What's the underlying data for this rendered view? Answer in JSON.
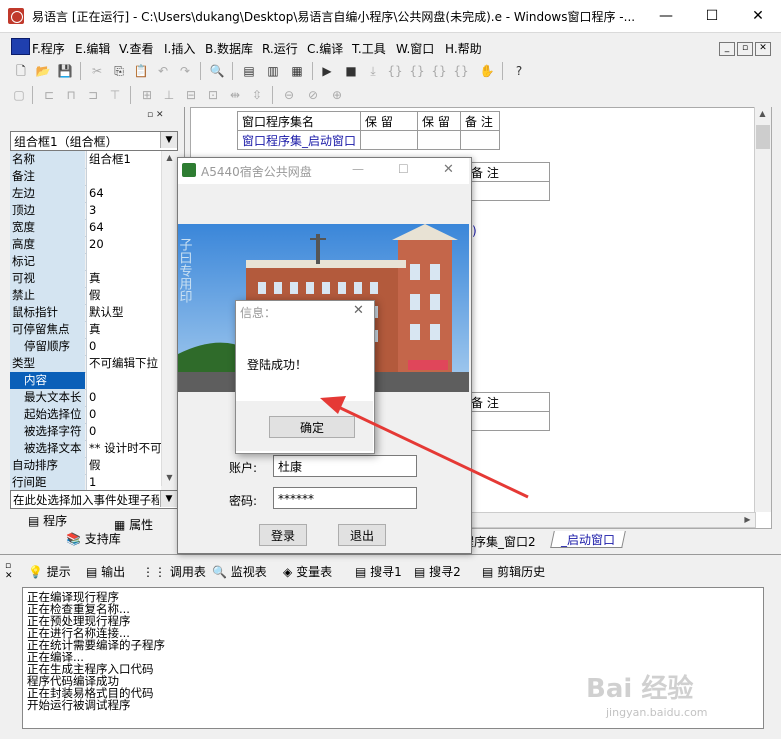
{
  "window": {
    "title": "易语言 [正在运行] - C:\\Users\\dukang\\Desktop\\易语言自编小程序\\公共网盘(未完成).e - Windows窗口程序 -...",
    "minimize": "—",
    "maximize": "☐",
    "close": "✕"
  },
  "menu": [
    "F.程序",
    "E.编辑",
    "V.查看",
    "I.插入",
    "B.数据库",
    "R.运行",
    "C.编译",
    "T.工具",
    "W.窗口",
    "H.帮助"
  ],
  "left_panel": {
    "combo": "组合框1（组合框）",
    "properties": [
      {
        "name": "名称",
        "value": "组合框1"
      },
      {
        "name": "备注",
        "value": ""
      },
      {
        "name": "左边",
        "value": "64"
      },
      {
        "name": "顶边",
        "value": "3"
      },
      {
        "name": "宽度",
        "value": "64"
      },
      {
        "name": "高度",
        "value": "20"
      },
      {
        "name": "标记",
        "value": ""
      },
      {
        "name": "可视",
        "value": "真"
      },
      {
        "name": "禁止",
        "value": "假"
      },
      {
        "name": "鼠标指针",
        "value": "默认型"
      },
      {
        "name": "可停留焦点",
        "value": "真"
      },
      {
        "name": "停留顺序",
        "value": "0"
      },
      {
        "name": "类型",
        "value": "不可编辑下拉"
      },
      {
        "name": "内容",
        "value": ""
      },
      {
        "name": "最大文本长",
        "value": "0"
      },
      {
        "name": "起始选择位",
        "value": "0"
      },
      {
        "name": "被选择字符",
        "value": "0"
      },
      {
        "name": "被选择文本",
        "value": "** 设计时不可"
      },
      {
        "name": "自动排序",
        "value": "假"
      },
      {
        "name": "行间距",
        "value": "1"
      }
    ],
    "event_combo": "在此处选择加入事件处理子程序",
    "tabs": {
      "program": "程序",
      "properties": "属性",
      "support": "支持库"
    }
  },
  "editor": {
    "table1": [
      "窗口程序集名",
      "保 留",
      "保 留",
      "备 注"
    ],
    "table1_row": "窗口程序集_启动窗口",
    "table2_header": "备 注",
    "table3_header": "备 注",
    "tab_labels": [
      "程序集_窗口2",
      "_启动窗口"
    ]
  },
  "app_window": {
    "title": "A5440宿舍公共网盘",
    "photo_caption": "子曰专用印",
    "account_label": "账户:",
    "account_value": "杜康",
    "password_label": "密码:",
    "password_value": "******",
    "login_button": "登录",
    "exit_button": "退出"
  },
  "message_box": {
    "title": "信息：",
    "text": "登陆成功！",
    "ok": "确定"
  },
  "bottom_tabs": [
    "提示",
    "输出",
    "调用表",
    "监视表",
    "变量表",
    "搜寻1",
    "搜寻2",
    "剪辑历史"
  ],
  "output_lines": [
    "正在编译现行程序",
    "正在检查重复名称...",
    "正在预处理现行程序",
    "正在进行名称连接...",
    "正在统计需要编译的子程序",
    "正在编译...",
    "正在生成主程序入口代码",
    "程序代码编译成功",
    "正在封装易格式目的代码",
    "开始运行被调试程序"
  ],
  "watermark": {
    "main": "Bai 经验",
    "sub": "jingyan.baidu.com"
  },
  "colors": {
    "accent": "#0a5fb8",
    "link_blue": "#1a1aa8",
    "arrow_red": "#e53935"
  }
}
